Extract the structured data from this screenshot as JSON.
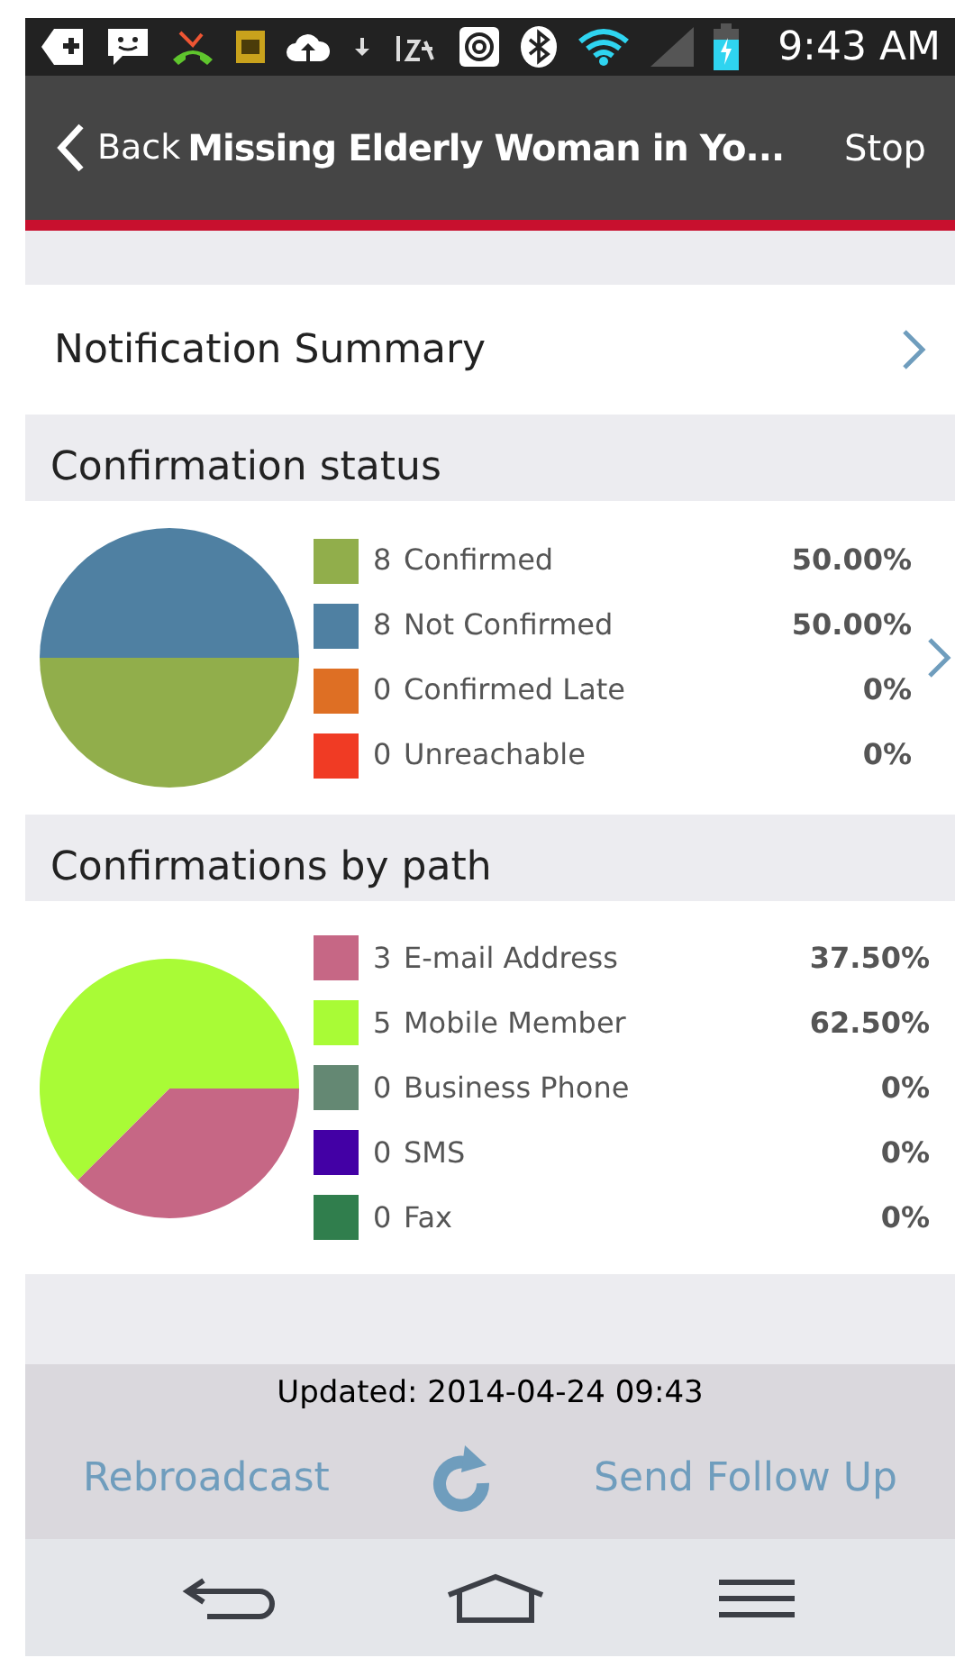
{
  "status_bar": {
    "time": "9:43 AM"
  },
  "nav_bar": {
    "back": "Back",
    "title": "Missing Elderly Woman in Yo...",
    "action": "Stop"
  },
  "summary_row": {
    "label": "Notification Summary"
  },
  "sections": [
    {
      "title": "Confirmation status",
      "has_chevron": true,
      "legend": [
        {
          "count": "8",
          "percent": "50.00%",
          "color": "#91ae4b"
        },
        {
          "count": "8",
          "percent": "50.00%",
          "color": "#4f80a2"
        },
        {
          "count": "0",
          "percent": "0%",
          "color": "#de6f24"
        },
        {
          "count": "0",
          "percent": "0%",
          "color": "#f03b24"
        }
      ],
      "chart_data": {
        "type": "pie",
        "categories": [
          "Confirmed",
          "Not Confirmed",
          "Confirmed Late",
          "Unreachable"
        ],
        "series": [
          {
            "values": [
              50,
              50,
              0,
              0
            ]
          }
        ]
      }
    },
    {
      "title": "Confirmations by path",
      "has_chevron": false,
      "legend": [
        {
          "count": "3",
          "percent": "37.50%",
          "color": "#c66785"
        },
        {
          "count": "5",
          "percent": "62.50%",
          "color": "#a9fb36"
        },
        {
          "count": "0",
          "percent": "0%",
          "color": "#648873"
        },
        {
          "count": "0",
          "percent": "0%",
          "color": "#4300a5"
        },
        {
          "count": "0",
          "percent": "0%",
          "color": "#307e4d"
        }
      ],
      "chart_data": {
        "type": "pie",
        "categories": [
          "E-mail Address",
          "Mobile Member",
          "Business Phone",
          "SMS",
          "Fax"
        ],
        "series": [
          {
            "values": [
              37.5,
              62.5,
              0,
              0,
              0
            ]
          }
        ]
      }
    }
  ],
  "footer": {
    "updated": "Updated: 2014-04-24 09:43",
    "buttons": [
      "Rebroadcast",
      "Send Follow Up"
    ]
  }
}
